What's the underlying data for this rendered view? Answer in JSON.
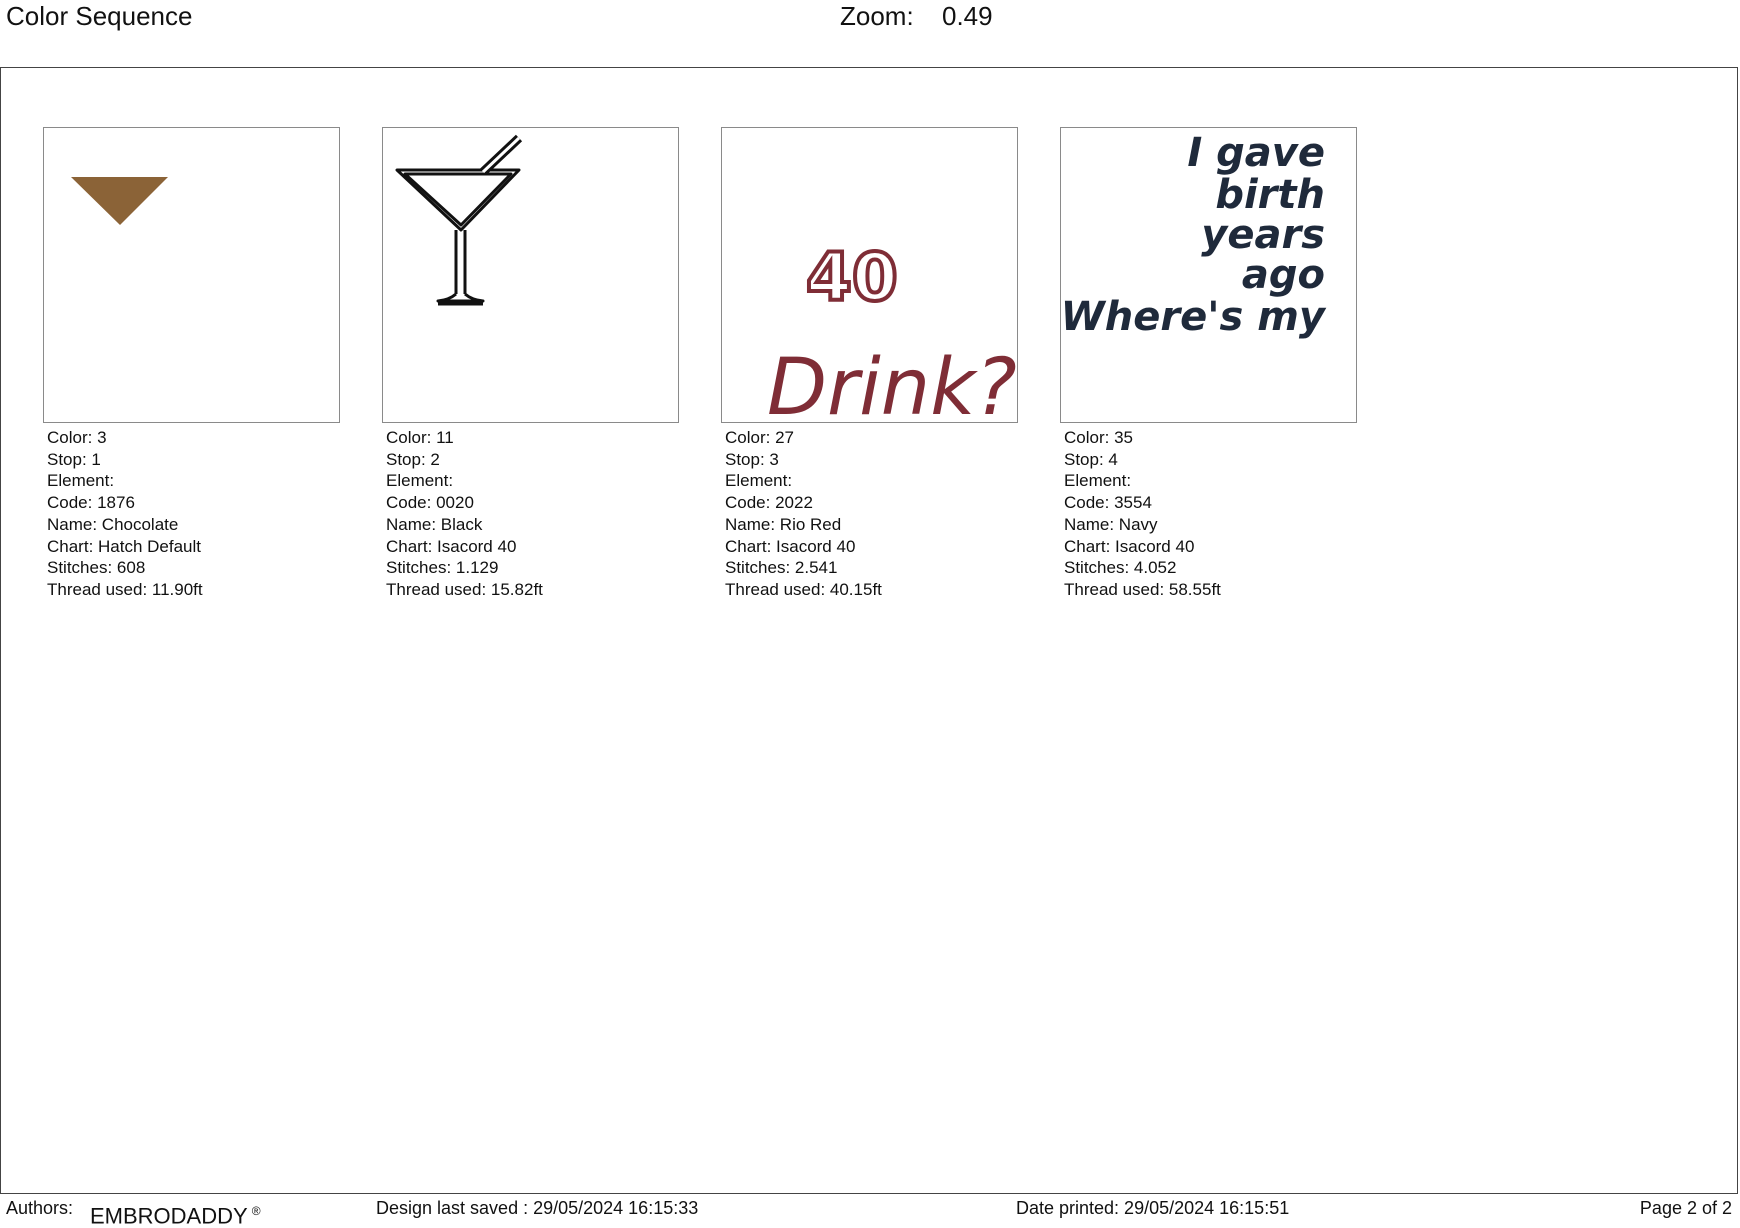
{
  "header": {
    "title": "Color Sequence",
    "zoom_label": "Zoom:",
    "zoom_value": "0.49"
  },
  "colors": {
    "chocolate": "#8b6337",
    "black": "#111111",
    "rio_red": "#7f2d36",
    "navy": "#1f2a3b"
  },
  "cards": [
    {
      "icon": "triangle-stitch-icon",
      "color": "Color: 3",
      "stop": "Stop: 1",
      "element": "Element:",
      "code": "Code: 1876",
      "name": "Name: Chocolate",
      "chart": "Chart: Hatch Default",
      "stitches": "Stitches: 608",
      "thread": "Thread used: 11.90ft"
    },
    {
      "icon": "martini-glass-icon",
      "color": "Color: 11",
      "stop": "Stop: 2",
      "element": "Element:",
      "code": "Code: 0020",
      "name": "Name: Black",
      "chart": "Chart: Isacord 40",
      "stitches": "Stitches: 1.129",
      "thread": "Thread used: 15.82ft"
    },
    {
      "icon": "text-stitch-icon",
      "art_number": "40",
      "art_word": "Drink?",
      "color": "Color: 27",
      "stop": "Stop: 3",
      "element": "Element:",
      "code": "Code: 2022",
      "name": "Name: Rio Red",
      "chart": "Chart: Isacord 40",
      "stitches": "Stitches: 2.541",
      "thread": "Thread used: 40.15ft"
    },
    {
      "icon": "text-stitch-icon",
      "art_lines": [
        "I gave",
        "birth",
        "years",
        "ago",
        "Where's my"
      ],
      "color": "Color: 35",
      "stop": "Stop: 4",
      "element": "Element:",
      "code": "Code: 3554",
      "name": "Name: Navy",
      "chart": "Chart: Isacord 40",
      "stitches": "Stitches: 4.052",
      "thread": "Thread used: 58.55ft"
    }
  ],
  "footer": {
    "authors_label": "Authors:",
    "authors_value": "EMBRODADDY",
    "authors_mark": "®",
    "saved": "Design last saved : 29/05/2024 16:15:33",
    "printed": "Date printed: 29/05/2024 16:15:51",
    "page": "Page 2 of 2"
  }
}
